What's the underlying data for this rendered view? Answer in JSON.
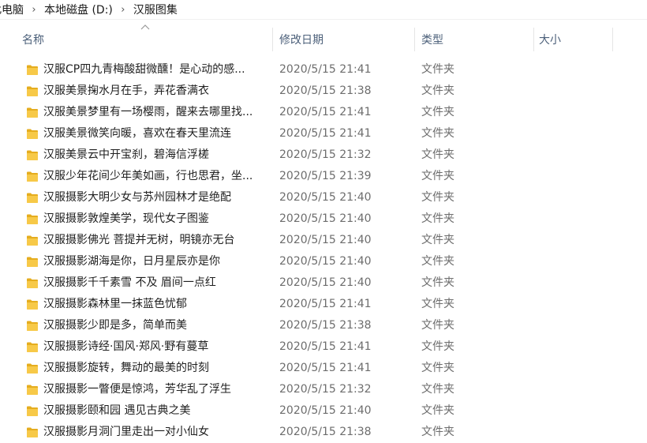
{
  "address_bar": {
    "crumbs": [
      "此电脑",
      "本地磁盘 (D:)",
      "汉服图集"
    ],
    "separator": "›"
  },
  "columns": {
    "name": "名称",
    "date": "修改日期",
    "type": "类型",
    "size": "大小",
    "sort_indicator": "^"
  },
  "accent_colors": {
    "folder": "#f7c948",
    "folder_dark": "#e5ad1f",
    "header_text": "#4c607a"
  },
  "files": [
    {
      "name": "汉服CP四九青梅酸甜微醺！是心动的感...",
      "date": "2020/5/15 21:41",
      "type": "文件夹",
      "size": ""
    },
    {
      "name": "汉服美景掬水月在手，弄花香满衣",
      "date": "2020/5/15 21:38",
      "type": "文件夹",
      "size": ""
    },
    {
      "name": "汉服美景梦里有一场樱雨，醒来去哪里找...",
      "date": "2020/5/15 21:41",
      "type": "文件夹",
      "size": ""
    },
    {
      "name": "汉服美景微笑向暖，喜欢在春天里流连",
      "date": "2020/5/15 21:41",
      "type": "文件夹",
      "size": ""
    },
    {
      "name": "汉服美景云中开宝刹，碧海信浮槎",
      "date": "2020/5/15 21:32",
      "type": "文件夹",
      "size": ""
    },
    {
      "name": "汉服少年花间少年美如画，行也思君，坐...",
      "date": "2020/5/15 21:39",
      "type": "文件夹",
      "size": ""
    },
    {
      "name": "汉服摄影大明少女与苏州园林才是绝配",
      "date": "2020/5/15 21:40",
      "type": "文件夹",
      "size": ""
    },
    {
      "name": "汉服摄影敦煌美学，现代女子图鉴",
      "date": "2020/5/15 21:40",
      "type": "文件夹",
      "size": ""
    },
    {
      "name": "汉服摄影佛光 菩提并无树，明镜亦无台",
      "date": "2020/5/15 21:40",
      "type": "文件夹",
      "size": ""
    },
    {
      "name": "汉服摄影湖海是你，日月星辰亦是你",
      "date": "2020/5/15 21:40",
      "type": "文件夹",
      "size": ""
    },
    {
      "name": "汉服摄影千千素雪 不及 眉间一点红",
      "date": "2020/5/15 21:40",
      "type": "文件夹",
      "size": ""
    },
    {
      "name": "汉服摄影森林里一抹蓝色忧郁",
      "date": "2020/5/15 21:41",
      "type": "文件夹",
      "size": ""
    },
    {
      "name": "汉服摄影少即是多，简单而美",
      "date": "2020/5/15 21:38",
      "type": "文件夹",
      "size": ""
    },
    {
      "name": "汉服摄影诗经·国风·郑风·野有蔓草",
      "date": "2020/5/15 21:41",
      "type": "文件夹",
      "size": ""
    },
    {
      "name": "汉服摄影旋转，舞动的最美的时刻",
      "date": "2020/5/15 21:41",
      "type": "文件夹",
      "size": ""
    },
    {
      "name": "汉服摄影一瞥便是惊鸿，芳华乱了浮生",
      "date": "2020/5/15 21:32",
      "type": "文件夹",
      "size": ""
    },
    {
      "name": "汉服摄影颐和园 遇见古典之美",
      "date": "2020/5/15 21:40",
      "type": "文件夹",
      "size": ""
    },
    {
      "name": "汉服摄影月洞门里走出一对小仙女",
      "date": "2020/5/15 21:38",
      "type": "文件夹",
      "size": ""
    }
  ]
}
